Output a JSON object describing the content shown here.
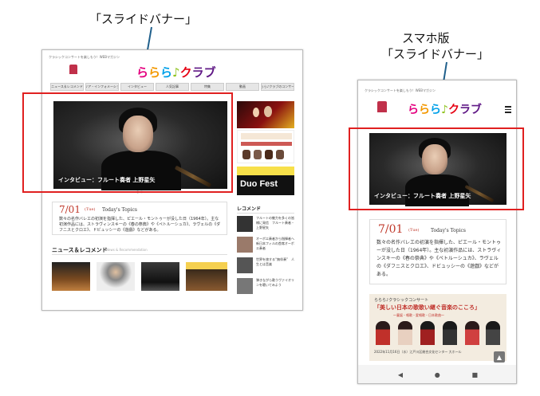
{
  "annotations": {
    "desktop_label": "「スライドバナー」",
    "mobile_label_line1": "スマホ版",
    "mobile_label_line2": "「スライドバナー」"
  },
  "desktop": {
    "tagline": "クラシックコンサートを楽しもう！WEBマガジン",
    "logo": [
      "ら",
      "ら",
      "ら",
      "♪",
      "ク",
      "ラブ"
    ],
    "nav": [
      "ニュース＆レコメンド",
      "エリア・インフォメーション",
      "インタビュー",
      "人気記事",
      "特集",
      "動画",
      "ららら♪クラブのコンサート"
    ],
    "slider_caption": "インタビュー：フルート奏者 上野星矢",
    "dots": "● ○",
    "date": "7/01",
    "weekday": "(Tue)",
    "todays_topics": "Today's Topics",
    "topic_text": "数々の名作バレエの初演を指揮した、ピエール・モントゥーが没した日（1964年）。主な初演作品には、ストラヴィンスキーの《春の祭典》や《ペトルーシュカ》、ラヴェルの《ダフニスとクロエ》、ドビュッシーの《遊戯》などがある。",
    "side_ad_2": "Duo Fest",
    "news_title": "ニュース＆レコメンド",
    "news_sub": "News & Recommendation",
    "recommend_title": "レコメンド",
    "recommend_items": [
      "フルートの魅力を多くの皆様に発信　フルート奏者・上野星矢",
      "オーボエ奏者から指揮者へ　新日本フィルの首席オーボエ奏者",
      "世界を旅する“無伴奏”　人生とは音楽",
      "弾きながら歌うヴァイオリンを聴いてみよう"
    ]
  },
  "mobile": {
    "tagline": "クラシックコンサートを楽しもう！WEBマガジン",
    "logo": [
      "ら",
      "ら",
      "ら",
      "♪",
      "ク",
      "ラブ"
    ],
    "menu_icon": "hamburger-icon",
    "slider_caption": "インタビュー：フルート奏者 上野星矢",
    "date": "7/01",
    "weekday": "(Tue)",
    "todays_topics": "Today's Topics",
    "topic_text": "数々の名作バレエの初演を指揮した、ピエール・モントゥーが没した日（1964年）。主な初演作品には、ストラヴィンスキーの《春の祭典》や《ペトルーシュカ》、ラヴェルの《ダフニスとクロエ》、ドビュッシーの《遊戯》などがある。",
    "concert_kicker": "ららら♪クラシックコンサート",
    "concert_title": "「美しい日本の歌歌い継ぐ音楽のこころ」",
    "concert_subtitle": "〜童謡・唱歌・愛唱歌・日本歌曲〜",
    "concert_date": "2022年11月16日（水）江戸川区総合文化センター 大ホール",
    "scroll_top": "▲",
    "nav_buttons": [
      "◀",
      "●",
      "■"
    ]
  },
  "colors": {
    "annotation_red": "#e02020",
    "date_red": "#c0392b",
    "arrow": "#1f5f8b"
  }
}
